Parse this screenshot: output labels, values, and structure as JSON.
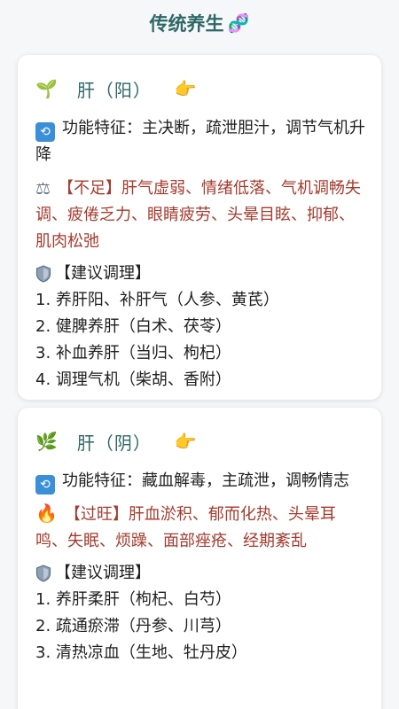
{
  "header": {
    "title": "传统养生",
    "title_icon": "🧬"
  },
  "cards": [
    {
      "organ_icon": "🌱",
      "organ": "肝（阳）",
      "pointer_icon": "👉",
      "function_icon": "cycle-icon",
      "function_text": "功能特征：主决断，疏泄胆汁，调节气机升降",
      "symptom_icon": "scales-icon",
      "symptom_text": "【不足】肝气虚弱、情绪低落、气机调畅失调、疲倦乏力、眼睛疲劳、头晕目眩、抑郁、肌肉松弛",
      "advice_icon": "shield-icon",
      "advice_title": "【建议调理】",
      "advice": [
        "1. 养肝阳、补肝气（人参、黄芪）",
        "2. 健脾养肝（白术、茯苓）",
        "3. 补血养肝（当归、枸杞）",
        "4. 调理气机（柴胡、香附）"
      ]
    },
    {
      "organ_icon": "🌿",
      "organ": "肝（阴）",
      "pointer_icon": "👉",
      "function_icon": "cycle-icon",
      "function_text": "功能特征：藏血解毒，主疏泄，调畅情志",
      "symptom_icon": "🔥",
      "symptom_text": "【过旺】肝血淤积、郁而化热、头晕耳鸣、失眠、烦躁、面部痤疮、经期紊乱",
      "advice_icon": "shield-icon",
      "advice_title": "【建议调理】",
      "advice": [
        "1. 养肝柔肝（枸杞、白芍）",
        "2. 疏通瘀滞（丹参、川芎）",
        "3. 清热凉血（生地、牡丹皮）"
      ]
    }
  ]
}
